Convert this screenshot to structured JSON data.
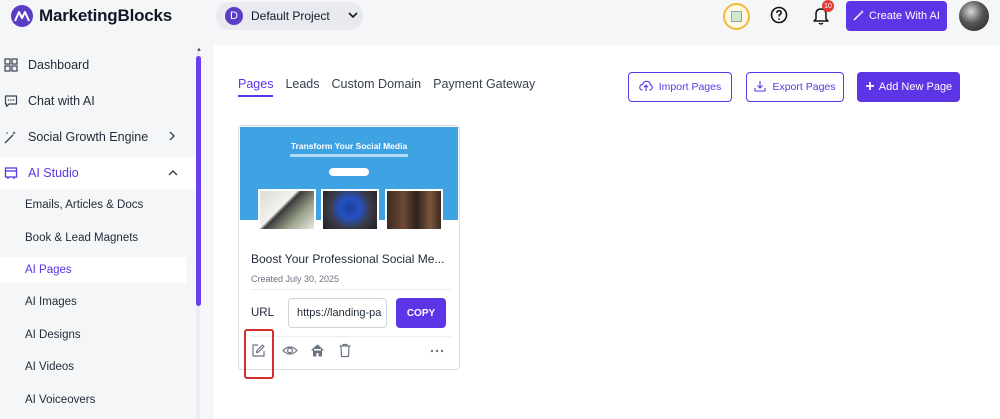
{
  "app": {
    "brand": "MarketingBlocks",
    "project": {
      "initial": "D",
      "name": "Default Project"
    },
    "notifications_count": "10",
    "create_label": "Create With AI"
  },
  "sidebar": {
    "items": [
      {
        "label": "Dashboard",
        "icon": "grid-icon"
      },
      {
        "label": "Chat with AI",
        "icon": "chat-icon"
      },
      {
        "label": "Social Growth Engine",
        "icon": "magic-wand-icon"
      },
      {
        "label": "AI Studio",
        "icon": "studio-icon",
        "expanded": true
      }
    ],
    "sub_items": [
      {
        "label": "Emails, Articles & Docs"
      },
      {
        "label": "Book & Lead Magnets"
      },
      {
        "label": "AI Pages",
        "selected": true
      },
      {
        "label": "AI Images"
      },
      {
        "label": "AI Designs"
      },
      {
        "label": "AI Videos"
      },
      {
        "label": "AI Voiceovers"
      }
    ]
  },
  "main": {
    "tabs": [
      {
        "label": "Pages",
        "active": true
      },
      {
        "label": "Leads"
      },
      {
        "label": "Custom Domain"
      },
      {
        "label": "Payment Gateway"
      }
    ],
    "buttons": {
      "import": "Import Pages",
      "export": "Export Pages",
      "add": "Add New Page"
    },
    "card": {
      "thumbnail_heading": "Transform Your Social Media",
      "title": "Boost Your Professional Social Me...",
      "created": "Created July 30, 2025",
      "url_label": "URL",
      "url_value": "https://landing-pa",
      "copy_label": "COPY",
      "actions": [
        "edit-icon",
        "eye-icon",
        "home-icon",
        "trash-icon",
        "more-icon"
      ]
    }
  },
  "colors": {
    "accent": "#5b35e6",
    "highlight": "#d32f2f",
    "thumbnail_bg": "#3fa2e3"
  }
}
